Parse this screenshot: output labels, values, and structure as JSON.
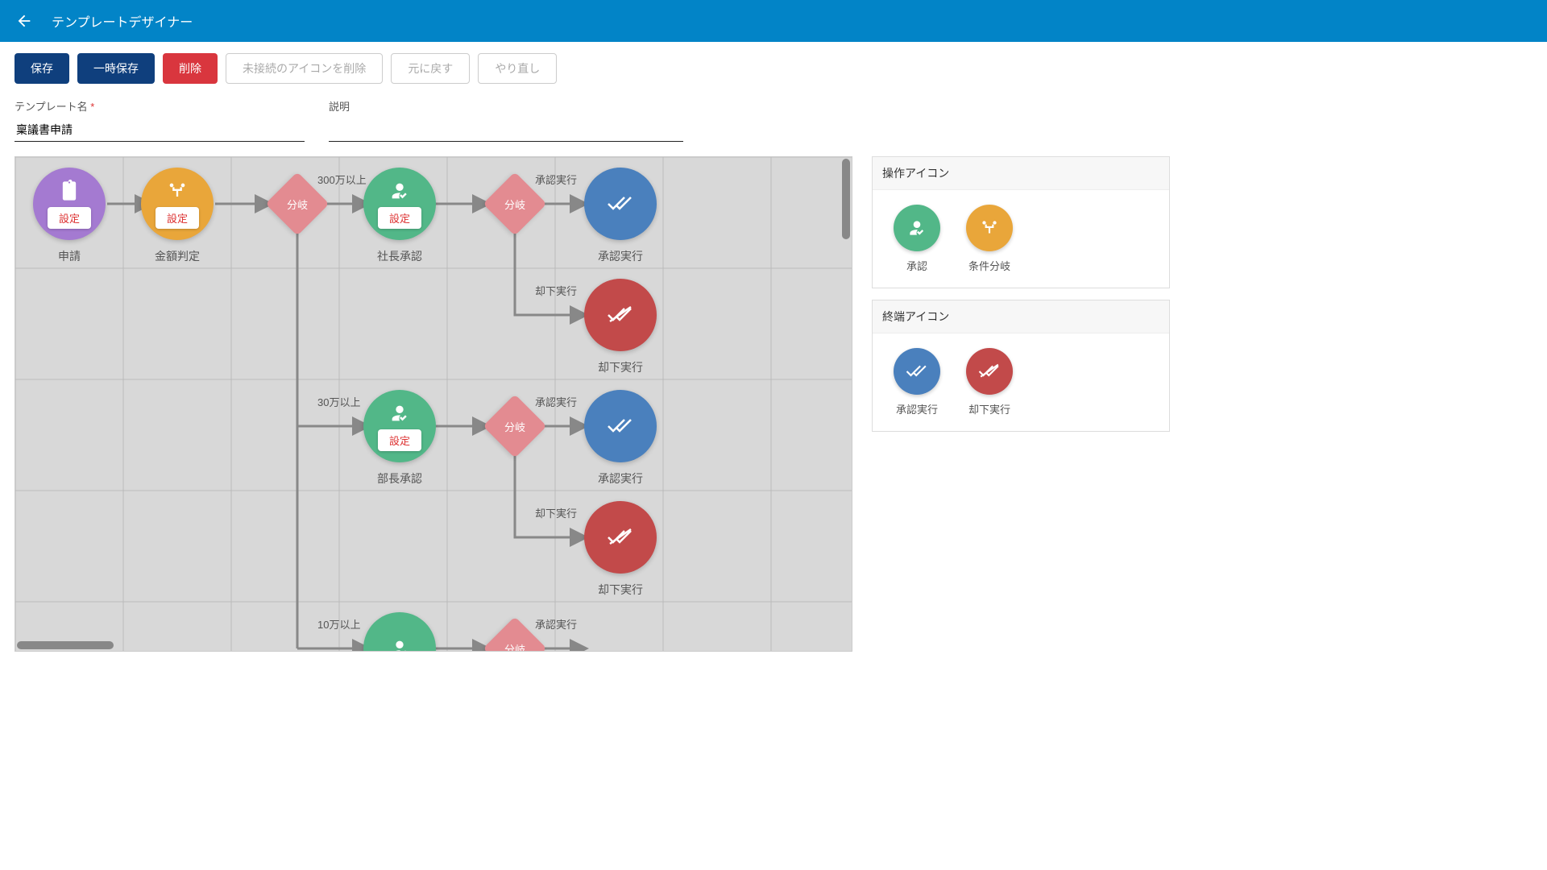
{
  "header": {
    "title": "テンプレートデザイナー"
  },
  "toolbar": {
    "save": "保存",
    "tempsave": "一時保存",
    "delete": "削除",
    "remove_orphans": "未接続のアイコンを削除",
    "undo": "元に戻す",
    "redo": "やり直し"
  },
  "form": {
    "name_label": "テンプレート名",
    "name_value": "稟議書申請",
    "desc_label": "説明",
    "desc_value": ""
  },
  "palette": {
    "ops_title": "操作アイコン",
    "ops": [
      {
        "label": "承認",
        "color": "green",
        "icon": "approve"
      },
      {
        "label": "条件分岐",
        "color": "orange",
        "icon": "branch"
      }
    ],
    "term_title": "終端アイコン",
    "terms": [
      {
        "label": "承認実行",
        "color": "blue",
        "icon": "check2"
      },
      {
        "label": "却下実行",
        "color": "red",
        "icon": "reject"
      }
    ]
  },
  "common": {
    "setting": "設定",
    "bunki": "分岐"
  },
  "nodes": {
    "apply": {
      "label": "申請"
    },
    "amount": {
      "label": "金額判定"
    },
    "pres": {
      "label": "社長承認"
    },
    "approve1": {
      "label": "承認実行"
    },
    "reject1": {
      "label": "却下実行"
    },
    "mgr": {
      "label": "部長承認"
    },
    "approve2": {
      "label": "承認実行"
    },
    "reject2": {
      "label": "却下実行"
    }
  },
  "branches": {
    "b300": "300万以上",
    "b30": "30万以上",
    "b10": "10万以上",
    "exec_ok": "承認実行",
    "exec_ng": "却下実行"
  }
}
